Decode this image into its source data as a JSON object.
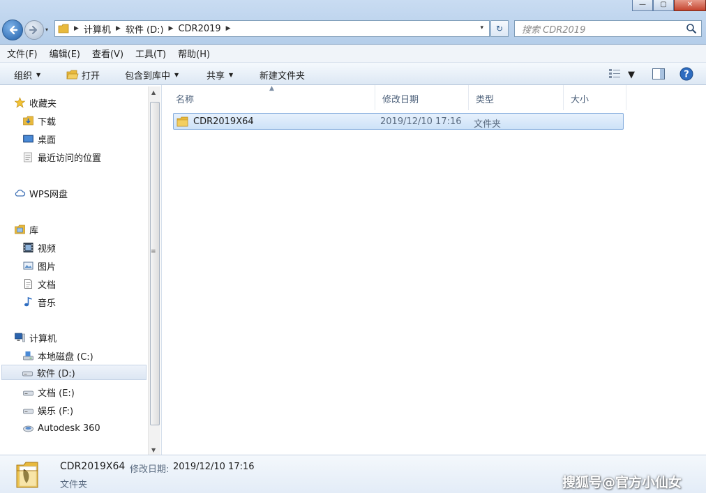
{
  "window": {
    "controls": {
      "minimize": "—",
      "maximize": "▢",
      "close": "✕"
    }
  },
  "nav": {
    "back_icon": "back-arrow-icon",
    "forward_icon": "forward-arrow-icon",
    "recent_dropdown": "▾"
  },
  "address": {
    "breadcrumbs": [
      "计算机",
      "软件 (D:)",
      "CDR2019"
    ],
    "separator": "▶",
    "dropdown": "▾",
    "refresh": "↻"
  },
  "search": {
    "placeholder": "搜索 CDR2019"
  },
  "menubar": {
    "items": [
      "文件(F)",
      "编辑(E)",
      "查看(V)",
      "工具(T)",
      "帮助(H)"
    ]
  },
  "toolbar": {
    "organize": "组织",
    "open": "打开",
    "include_in_library": "包含到库中",
    "share": "共享",
    "new_folder": "新建文件夹",
    "dropdown_arrow": "▼"
  },
  "sidebar": {
    "favorites": {
      "label": "收藏夹",
      "items": [
        "下载",
        "桌面",
        "最近访问的位置"
      ]
    },
    "wps": {
      "label": "WPS网盘"
    },
    "libraries": {
      "label": "库",
      "items": [
        "视频",
        "图片",
        "文档",
        "音乐"
      ]
    },
    "computer": {
      "label": "计算机",
      "items": [
        "本地磁盘 (C:)",
        "软件 (D:)",
        "文档 (E:)",
        "娱乐 (F:)",
        "Autodesk 360"
      ],
      "selected": "软件 (D:)"
    }
  },
  "columns": [
    "名称",
    "修改日期",
    "类型",
    "大小"
  ],
  "files": [
    {
      "name": "CDR2019X64",
      "modified": "2019/12/10 17:16",
      "type": "文件夹",
      "size": ""
    }
  ],
  "details": {
    "name": "CDR2019X64",
    "modified_label": "修改日期:",
    "modified_value": "2019/12/10 17:16",
    "type": "文件夹"
  },
  "watermark": "搜狐号@官方小仙女",
  "colors": {
    "accent": "#1f5ea8",
    "selection_bg": "#cde2f8",
    "selection_border": "#84acdd",
    "folder": "#e8b93c"
  }
}
